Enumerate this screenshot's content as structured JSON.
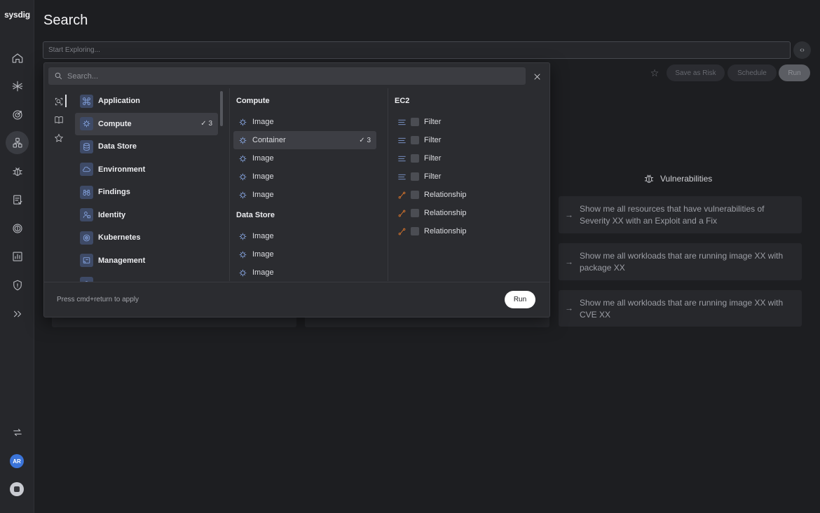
{
  "rail": {
    "logo": "sysdig",
    "avatar_initials": "AR",
    "items": [
      "home-icon",
      "integrations-icon",
      "target-icon",
      "inventory-icon",
      "bug-icon",
      "report-icon",
      "fingerprint-icon",
      "chart-icon",
      "shield-icon",
      "expand-icon"
    ],
    "bottom_items": [
      "sync-icon",
      "avatar",
      "help-icon"
    ]
  },
  "header": {
    "title": "Search",
    "explore_placeholder": "Start Exploring..."
  },
  "toolbar": {
    "save_as_risk": "Save as Risk",
    "schedule": "Schedule",
    "run": "Run"
  },
  "panel": {
    "search_placeholder": "Search...",
    "categories": [
      {
        "label": "Application",
        "icon": "command-icon",
        "count": ""
      },
      {
        "label": "Compute",
        "icon": "chip-icon",
        "count": "✓ 3",
        "selected": true
      },
      {
        "label": "Data Store",
        "icon": "database-icon",
        "count": ""
      },
      {
        "label": "Environment",
        "icon": "cloud-icon",
        "count": ""
      },
      {
        "label": "Findings",
        "icon": "binoculars-icon",
        "count": ""
      },
      {
        "label": "Identity",
        "icon": "identity-icon",
        "count": ""
      },
      {
        "label": "Kubernetes",
        "icon": "kubernetes-icon",
        "count": ""
      },
      {
        "label": "Management",
        "icon": "management-icon",
        "count": ""
      }
    ],
    "compute_heading": "Compute",
    "compute_items": [
      {
        "label": "Image",
        "count": ""
      },
      {
        "label": "Container",
        "count": "✓ 3",
        "selected": true
      },
      {
        "label": "Image",
        "count": ""
      },
      {
        "label": "Image",
        "count": ""
      },
      {
        "label": "Image",
        "count": ""
      }
    ],
    "datastore_heading": "Data Store",
    "datastore_items": [
      {
        "label": "Image"
      },
      {
        "label": "Image"
      },
      {
        "label": "Image"
      }
    ],
    "ec2_heading": "EC2",
    "ec2_items": [
      {
        "label": "Filter",
        "type": "filter"
      },
      {
        "label": "Filter",
        "type": "filter"
      },
      {
        "label": "Filter",
        "type": "filter"
      },
      {
        "label": "Filter",
        "type": "filter"
      },
      {
        "label": "Relationship",
        "type": "relationship"
      },
      {
        "label": "Relationship",
        "type": "relationship"
      },
      {
        "label": "Relationship",
        "type": "relationship"
      }
    ],
    "footer_hint": "Press cmd+return to apply",
    "footer_run": "Run"
  },
  "suggestions": {
    "heading": "Vulnerabilities",
    "cards": [
      "Show me all resources that have vulnerabilities of Severity XX with an Exploit and a Fix",
      "Show me all workloads that are running image XX with package XX",
      "Show me all workloads that are running image XX with CVE XX"
    ]
  },
  "colors": {
    "accent_blue": "#8fb0f0",
    "relationship_orange": "#e0782c",
    "avatar_blue": "#3b74d9"
  }
}
